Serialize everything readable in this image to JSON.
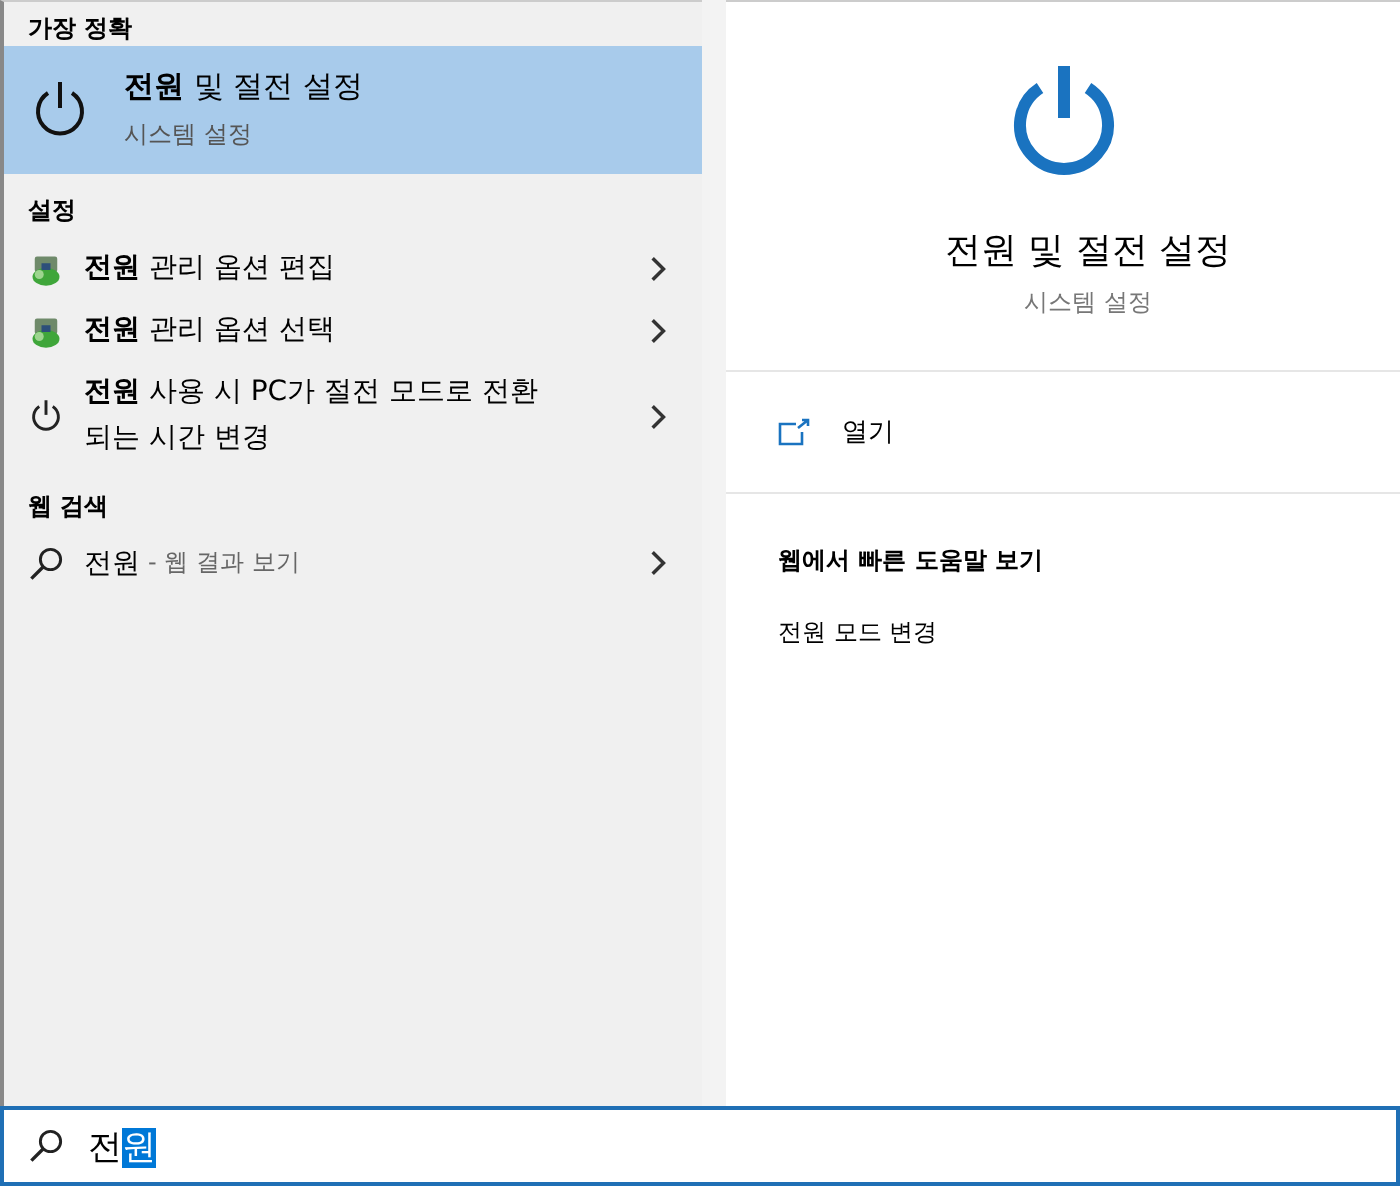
{
  "results": {
    "best_match_heading": "가장 정확",
    "best_match": {
      "title": "**전원** 및 절전 설정",
      "subtitle": "시스템 설정",
      "selected": true
    },
    "settings_heading": "설정",
    "settings": [
      {
        "kind": "control-panel",
        "label": "**전원** 관리 옵션 편집"
      },
      {
        "kind": "control-panel",
        "label": "**전원** 관리 옵션 선택"
      },
      {
        "kind": "power",
        "label": "**전원** 사용 시 PC가 절전 모드로 전환 되는 시간 변경"
      }
    ],
    "web_heading": "웹 검색",
    "web": [
      {
        "query": "전원",
        "hint": "- 웹 결과 보기"
      }
    ]
  },
  "preview": {
    "title": "전원 및 절전 설정",
    "subtitle": "시스템 설정",
    "actions": [
      {
        "label": "열기"
      }
    ],
    "help_heading": "웹에서 빠른 도움말 보기",
    "help_links": [
      "전원 모드 변경"
    ]
  },
  "search": {
    "value": "전",
    "selected_text": "원"
  }
}
